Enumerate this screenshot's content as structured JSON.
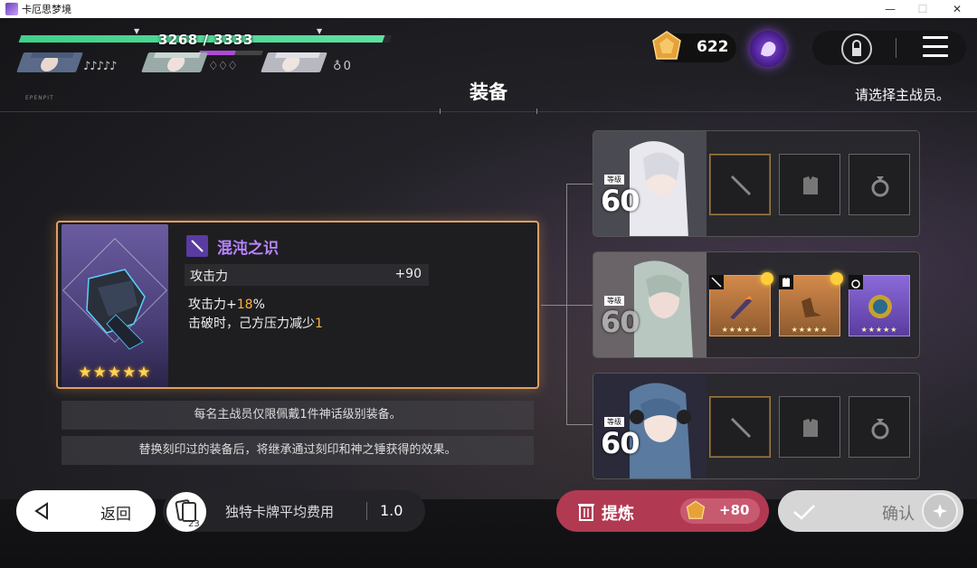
{
  "window": {
    "title": "卡厄思梦境",
    "minimize": "—",
    "maximize": "☐",
    "close": "✕"
  },
  "party": {
    "hp_text": "3268 / 3333",
    "hp_fraction": 0.98,
    "member1_info": "♪♪♪♪♪",
    "member2_info": "♢♢♢",
    "member3_info": "♁ 0"
  },
  "small_tag": "EPENPIT",
  "currency": {
    "gem_count": "622"
  },
  "page_title": "装备",
  "hint": "请选择主战员。",
  "equipment": {
    "name": "混沌之识",
    "stat_label": "攻击力",
    "stat_value": "+90",
    "effect1_prefix": "攻击力+",
    "effect1_value": "18",
    "effect1_suffix": "%",
    "effect2_prefix": "击破时，己方压力减少",
    "effect2_value": "1",
    "stars": "★★★★★"
  },
  "notes": [
    "每名主战员仅限佩戴1件神话级别装备。",
    "替换刻印过的装备后，将继承通过刻印和神之锤获得的效果。"
  ],
  "characters": [
    {
      "level_label": "等级",
      "level": "60"
    },
    {
      "level_label": "等级",
      "level": "60"
    },
    {
      "level_label": "等级",
      "level": "60"
    }
  ],
  "slot_stars": "★★★★★",
  "bottom": {
    "back_label": "返回",
    "deck_count": "23",
    "cost_label": "独特卡牌平均费用",
    "cost_value": "1.0",
    "refine_label": "提炼",
    "refine_reward": "+80",
    "confirm_label": "确认"
  },
  "colors": {
    "hp": "#3fd08a",
    "refine": "#b13a52",
    "accent_purple": "#b985ff",
    "highlight": "#ffb33a"
  }
}
